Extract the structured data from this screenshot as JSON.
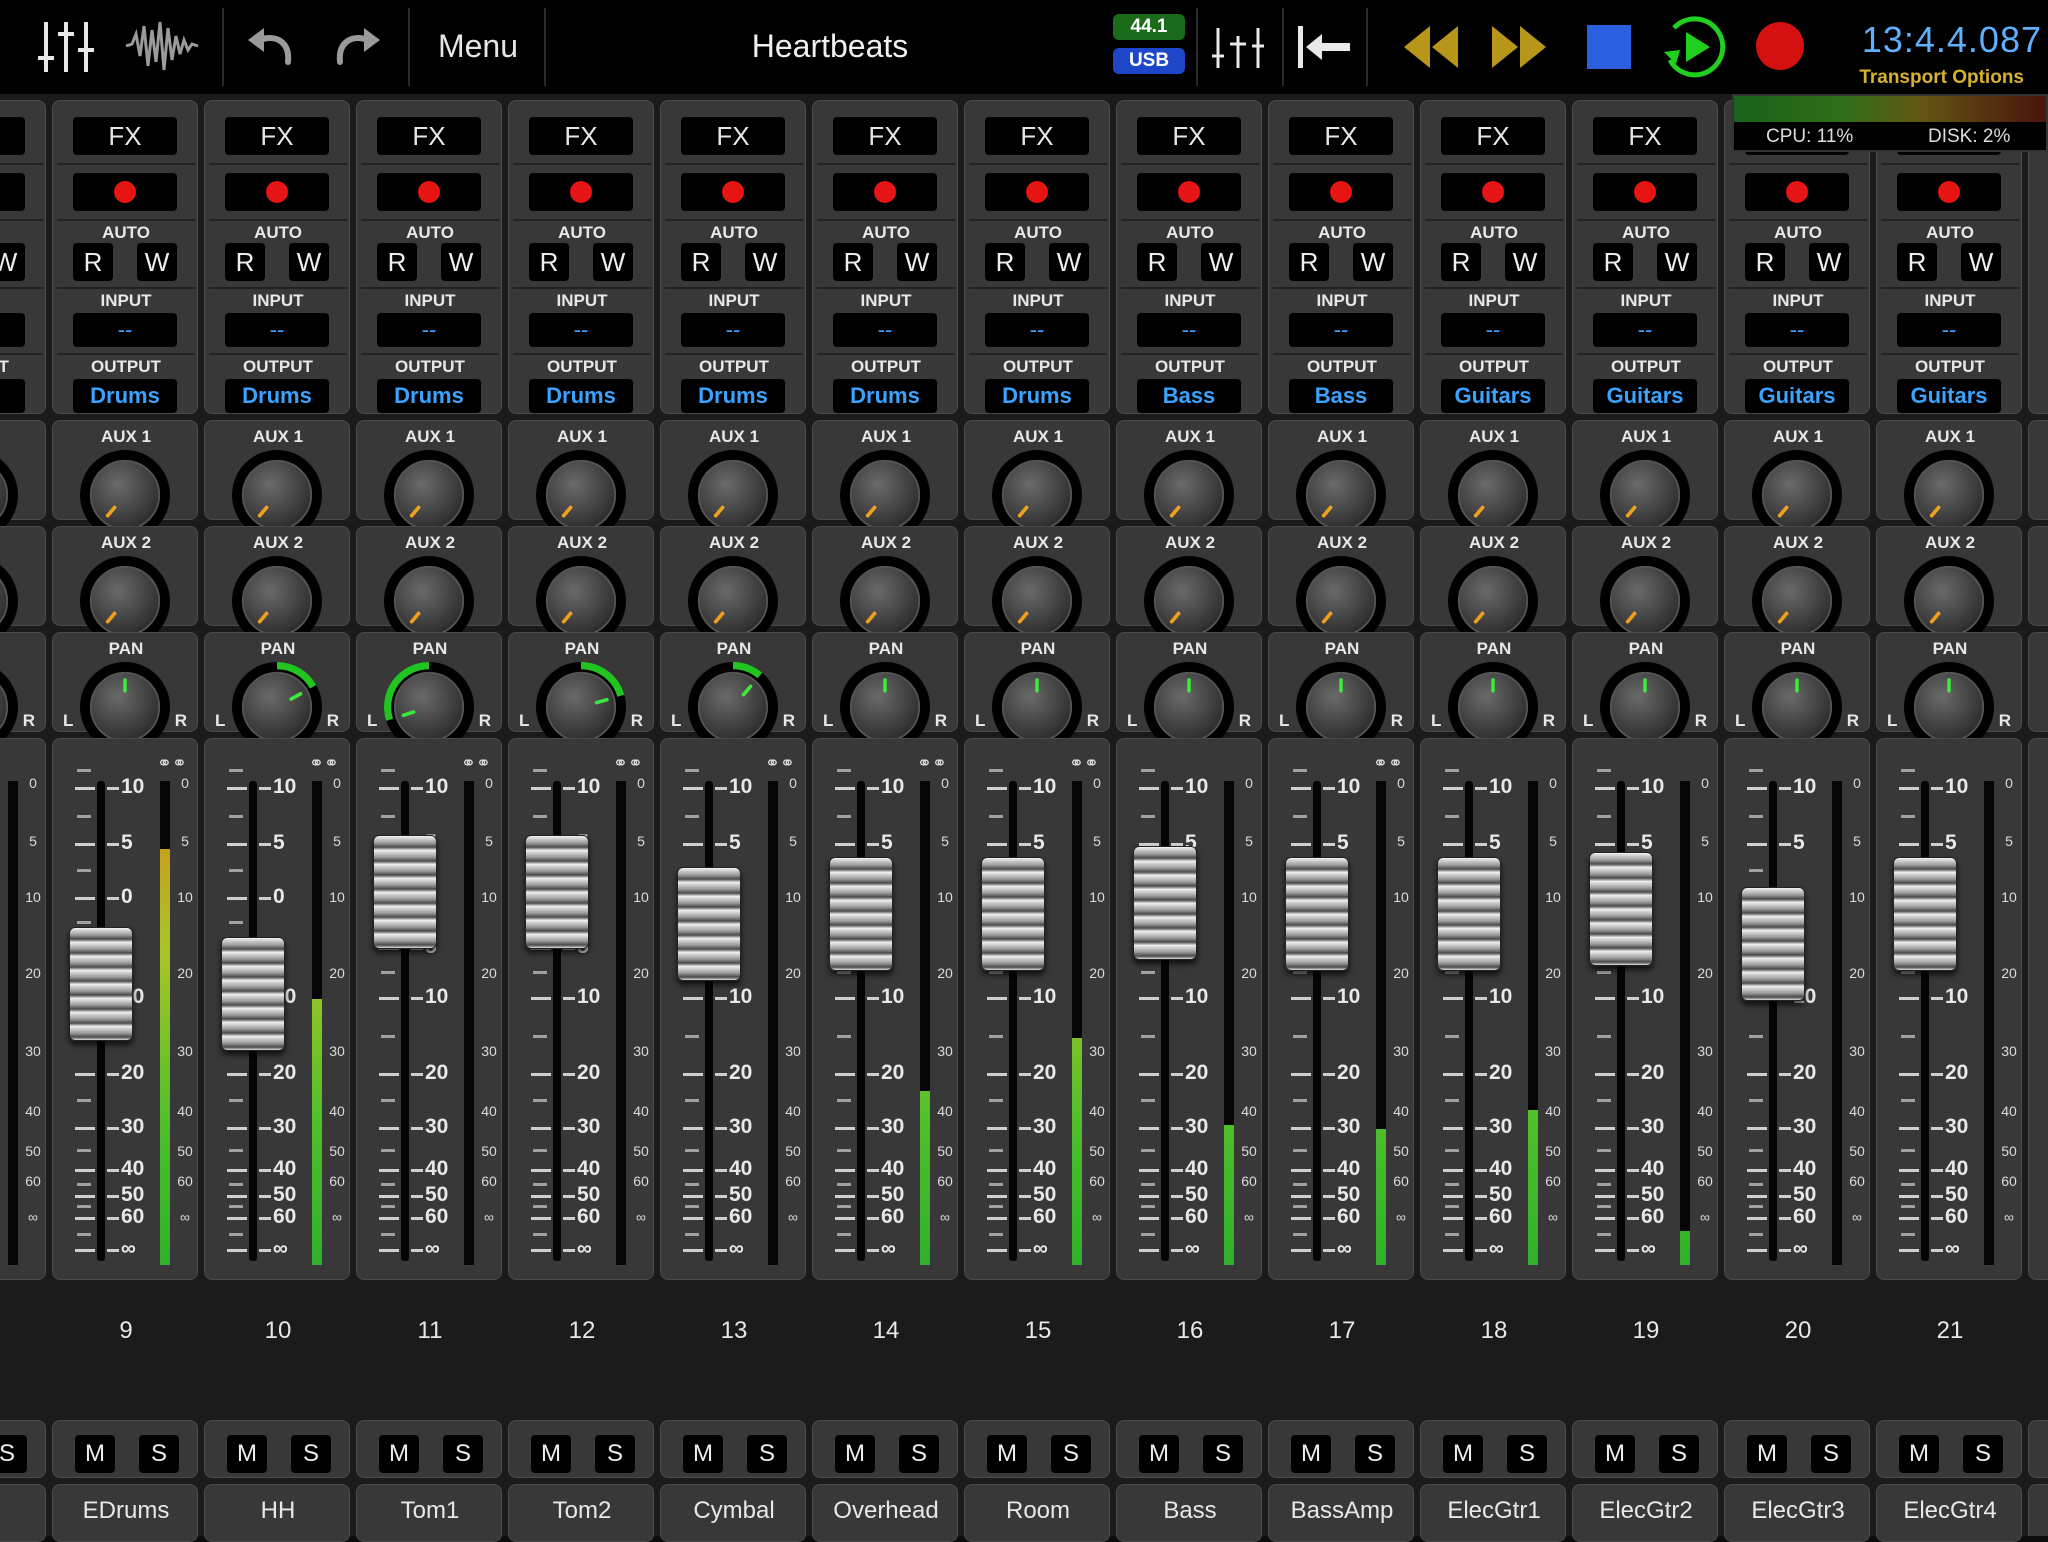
{
  "header": {
    "song_title": "Heartbeats",
    "menu_label": "Menu",
    "sample_rate": "44.1",
    "interface": "USB",
    "time": "13:4.4.087",
    "transport_options": "Transport Options",
    "cpu": "CPU:  11%",
    "disk": "DISK:  2%",
    "colors": {
      "time": "#5fb0ff",
      "transport_label": "#d8b22e",
      "play": "#1fd01f",
      "stop": "#2a5fe0",
      "record": "#d41010",
      "nav": "#b8961a"
    }
  },
  "labels": {
    "fx": "FX",
    "auto": "AUTO",
    "read": "R",
    "write": "W",
    "input": "INPUT",
    "output": "OUTPUT",
    "aux1": "AUX 1",
    "aux2": "AUX 2",
    "pan": "PAN",
    "left": "L",
    "right": "R",
    "mute": "M",
    "solo": "S",
    "fader_scale": [
      "10",
      "5",
      "0",
      "5",
      "10",
      "20",
      "30",
      "40",
      "50",
      "60",
      "∞"
    ],
    "meter_scale": [
      "0",
      "5",
      "10",
      "20",
      "30",
      "40",
      "50",
      "60",
      "∞"
    ]
  },
  "partial_left": {
    "read": "W",
    "output": "s",
    "mute": "S"
  },
  "channels": [
    {
      "number": "9",
      "name": "EDrums",
      "input": "--",
      "output": "Drums",
      "linked": true,
      "pan": 0,
      "fader_db": -7,
      "meter": 0.86
    },
    {
      "number": "10",
      "name": "HH",
      "input": "--",
      "output": "Drums",
      "linked": true,
      "pan": 0.45,
      "fader_db": -8,
      "meter": 0.55
    },
    {
      "number": "11",
      "name": "Tom1",
      "input": "--",
      "output": "Drums",
      "linked": true,
      "pan": -0.8,
      "fader_db": 2,
      "meter": 0
    },
    {
      "number": "12",
      "name": "Tom2",
      "input": "--",
      "output": "Drums",
      "linked": true,
      "pan": 0.55,
      "fader_db": 2,
      "meter": 0
    },
    {
      "number": "13",
      "name": "Cymbal",
      "input": "--",
      "output": "Drums",
      "linked": true,
      "pan": 0.3,
      "fader_db": -1,
      "meter": 0
    },
    {
      "number": "14",
      "name": "Overhead",
      "input": "--",
      "output": "Drums",
      "linked": true,
      "pan": 0,
      "fader_db": 0,
      "meter": 0.36
    },
    {
      "number": "15",
      "name": "Room",
      "input": "--",
      "output": "Drums",
      "linked": true,
      "pan": 0,
      "fader_db": 0,
      "meter": 0.47
    },
    {
      "number": "16",
      "name": "Bass",
      "input": "--",
      "output": "Bass",
      "linked": false,
      "pan": 0,
      "fader_db": 1,
      "meter": 0.29
    },
    {
      "number": "17",
      "name": "BassAmp",
      "input": "--",
      "output": "Bass",
      "linked": true,
      "pan": 0,
      "fader_db": 0,
      "meter": 0.28
    },
    {
      "number": "18",
      "name": "ElecGtr1",
      "input": "--",
      "output": "Guitars",
      "linked": false,
      "pan": 0,
      "fader_db": 0,
      "meter": 0.32
    },
    {
      "number": "19",
      "name": "ElecGtr2",
      "input": "--",
      "output": "Guitars",
      "linked": false,
      "pan": 0,
      "fader_db": 0.5,
      "meter": 0.07
    },
    {
      "number": "20",
      "name": "ElecGtr3",
      "input": "--",
      "output": "Guitars",
      "linked": false,
      "pan": 0,
      "fader_db": -3,
      "meter": 0
    },
    {
      "number": "21",
      "name": "ElecGtr4",
      "input": "--",
      "output": "Guitars",
      "linked": false,
      "pan": 0,
      "fader_db": 0,
      "meter": 0
    }
  ]
}
